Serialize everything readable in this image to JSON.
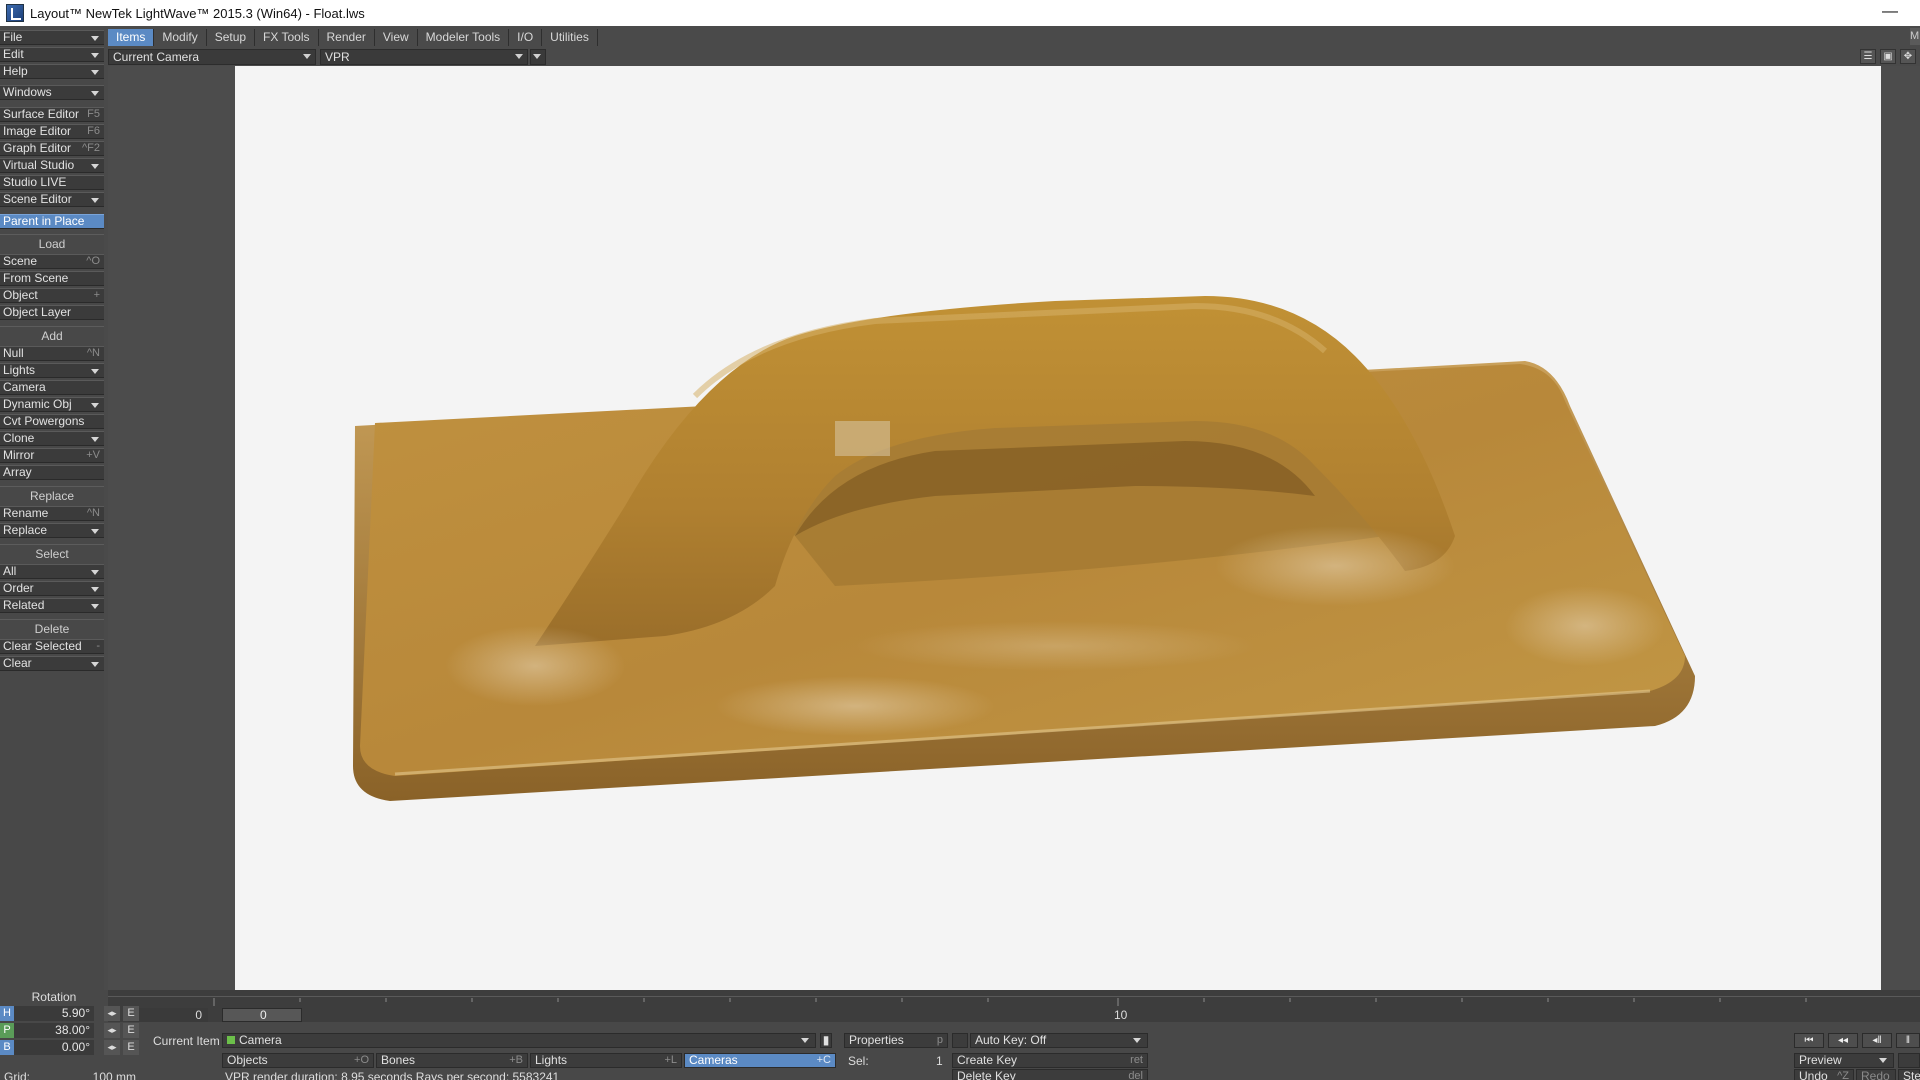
{
  "window": {
    "title": "Layout™ NewTek LightWave™ 2015.3 (Win64) - Float.lws",
    "minimize_label": "—"
  },
  "tabs": [
    "Items",
    "Modify",
    "Setup",
    "FX Tools",
    "Render",
    "View",
    "Modeler Tools",
    "I/O",
    "Utilities"
  ],
  "active_tab": "Items",
  "corner_label": "M",
  "viewport": {
    "camera_view": "Current Camera",
    "render_mode": "VPR"
  },
  "left_panel": {
    "menus": [
      "File",
      "Edit",
      "Help"
    ],
    "windows": "Windows",
    "editors": [
      {
        "label": "Surface Editor",
        "shortcut": "F5"
      },
      {
        "label": "Image Editor",
        "shortcut": "F6"
      },
      {
        "label": "Graph Editor",
        "shortcut": "^F2"
      },
      {
        "label": "Virtual Studio",
        "shortcut": ""
      },
      {
        "label": "Studio LIVE",
        "shortcut": ""
      },
      {
        "label": "Scene Editor",
        "shortcut": ""
      }
    ],
    "parent_in_place": "Parent in Place",
    "load_header": "Load",
    "load": [
      {
        "label": "Scene",
        "shortcut": "^O"
      },
      {
        "label": "From Scene",
        "shortcut": ""
      },
      {
        "label": "Object",
        "shortcut": "+"
      },
      {
        "label": "Object Layer",
        "shortcut": ""
      }
    ],
    "add_header": "Add",
    "add": [
      {
        "label": "Null",
        "shortcut": "^N"
      },
      {
        "label": "Lights",
        "shortcut": ""
      },
      {
        "label": "Camera",
        "shortcut": ""
      },
      {
        "label": "Dynamic Obj",
        "shortcut": ""
      },
      {
        "label": "Cvt Powergons",
        "shortcut": ""
      },
      {
        "label": "Clone",
        "shortcut": ""
      },
      {
        "label": "Mirror",
        "shortcut": "+V"
      },
      {
        "label": "Array",
        "shortcut": ""
      }
    ],
    "replace_header": "Replace",
    "replace": [
      {
        "label": "Rename",
        "shortcut": "^N"
      },
      {
        "label": "Replace",
        "shortcut": ""
      }
    ],
    "select_header": "Select",
    "select": [
      {
        "label": "All",
        "shortcut": ""
      },
      {
        "label": "Order",
        "shortcut": ""
      },
      {
        "label": "Related",
        "shortcut": ""
      }
    ],
    "delete_header": "Delete",
    "delete": [
      {
        "label": "Clear Selected",
        "shortcut": "-"
      },
      {
        "label": "Clear",
        "shortcut": ""
      }
    ]
  },
  "timeline": {
    "start_frame": "0",
    "current_frame": "0",
    "tick_10": "10"
  },
  "rotation": {
    "label": "Rotation",
    "h": {
      "axis": "H",
      "value": "5.90°"
    },
    "p": {
      "axis": "P",
      "value": "38.00°"
    },
    "b": {
      "axis": "B",
      "value": "0.00°"
    },
    "e_label": "E",
    "arrows_label": "◂▸"
  },
  "grid": {
    "label": "Grid:",
    "value": "100 mm"
  },
  "bottom_bar": {
    "current_item_label": "Current Item",
    "current_item_value": "Camera",
    "properties_label": "Properties",
    "properties_shortcut": "p",
    "auto_key": "Auto Key: Off",
    "objects": {
      "label": "Objects",
      "shortcut": "+O"
    },
    "bones": {
      "label": "Bones",
      "shortcut": "+B"
    },
    "lights": {
      "label": "Lights",
      "shortcut": "+L"
    },
    "cameras": {
      "label": "Cameras",
      "shortcut": "+C"
    },
    "sel_label": "Sel:",
    "sel_value": "1",
    "create_key": "Create Key",
    "create_key_shortcut": "ret",
    "delete_key": "Delete Key",
    "delete_key_shortcut": "del",
    "status": "VPR render duration: 8.95 seconds  Rays per second: 5583241",
    "preview": "Preview",
    "undo": "Undo",
    "undo_shortcut": "^Z",
    "redo": "Redo",
    "step": "Ste"
  },
  "colors": {
    "accent": "#5b8ac4",
    "panel": "#484848",
    "viewport_bg": "#f4f4f4",
    "float_body": "#b98a3c"
  },
  "icons": [
    "app-icon",
    "dropdown-arrow-icon",
    "transport-first-icon",
    "transport-prev-key-icon",
    "transport-play-back-icon",
    "transport-play-icon"
  ]
}
